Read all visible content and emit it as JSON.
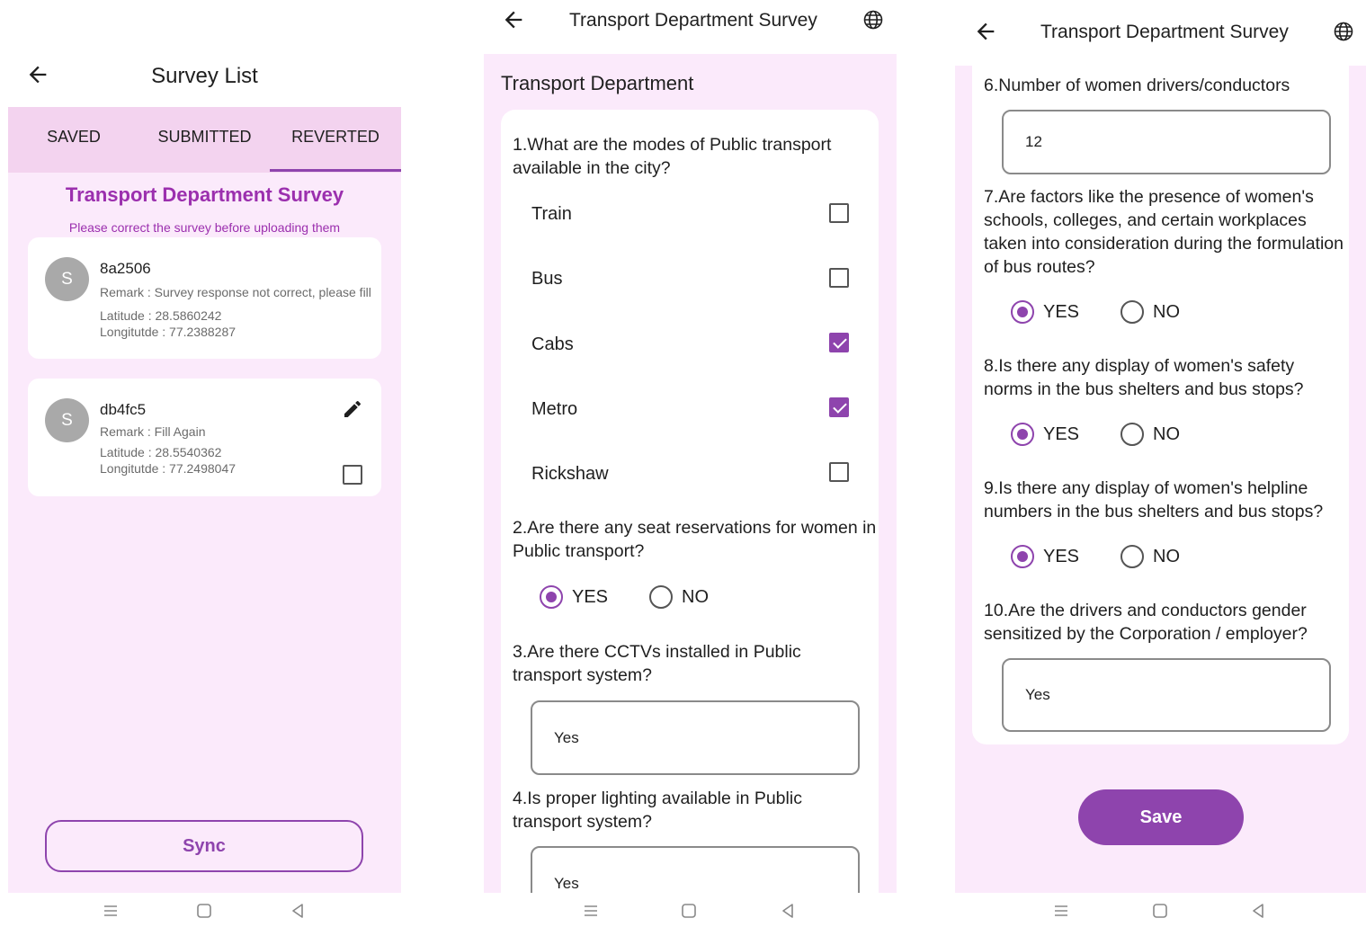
{
  "panel1": {
    "title": "Survey List",
    "tabs": [
      "SAVED",
      "SUBMITTED",
      "REVERTED"
    ],
    "active_tab": "REVERTED",
    "survey_title": "Transport Department Survey",
    "survey_subtitle": "Please correct the survey before uploading them",
    "items": [
      {
        "avatar": "S",
        "id": "8a2506",
        "remark": "Remark : Survey response not correct, please fill",
        "latitude": "Latitude : 28.5860242",
        "longitude": "Longitutde : 77.2388287"
      },
      {
        "avatar": "S",
        "id": "db4fc5",
        "remark": "Remark : Fill Again",
        "latitude": "Latitude : 28.5540362",
        "longitude": "Longitutde : 77.2498047",
        "checked": false
      }
    ],
    "sync_label": "Sync"
  },
  "panel2": {
    "title": "Transport Department Survey",
    "section_title": "Transport Department",
    "q1": "1.What are the modes of Public transport available in the city?",
    "q1_options": [
      {
        "label": "Train",
        "checked": false
      },
      {
        "label": "Bus",
        "checked": false
      },
      {
        "label": "Cabs",
        "checked": true
      },
      {
        "label": "Metro",
        "checked": true
      },
      {
        "label": "Rickshaw",
        "checked": false
      }
    ],
    "q2": "2.Are there any seat reservations for women in Public transport?",
    "q2_yes": "YES",
    "q2_no": "NO",
    "q2_selected": "YES",
    "q3": "3.Are there CCTVs installed in Public transport system?",
    "q3_value": "Yes",
    "q4": "4.Is proper lighting available in Public transport system?",
    "q4_value": "Yes"
  },
  "panel3": {
    "title": "Transport Department Survey",
    "q6": "6.Number of women drivers/conductors",
    "q6_value": "12",
    "q7": "7.Are factors like the presence of women's schools, colleges, and certain workplaces taken into consideration during the formulation of bus routes?",
    "q7_yes": "YES",
    "q7_no": "NO",
    "q7_selected": "YES",
    "q8": "8.Is there any display of women's safety norms in the bus shelters and bus stops?",
    "q8_yes": "YES",
    "q8_no": "NO",
    "q8_selected": "YES",
    "q9": "9.Is there any display of women's helpline numbers in the bus shelters and bus stops?",
    "q9_yes": "YES",
    "q9_no": "NO",
    "q9_selected": "YES",
    "q10": "10.Are the drivers and conductors gender sensitized by the Corporation / employer?",
    "q10_value": "Yes",
    "save_label": "Save"
  },
  "colors": {
    "accent": "#8e44ad",
    "title_purple": "#9b2fae",
    "background": "#fbeafb",
    "tabbar": "#f3d3ef"
  }
}
